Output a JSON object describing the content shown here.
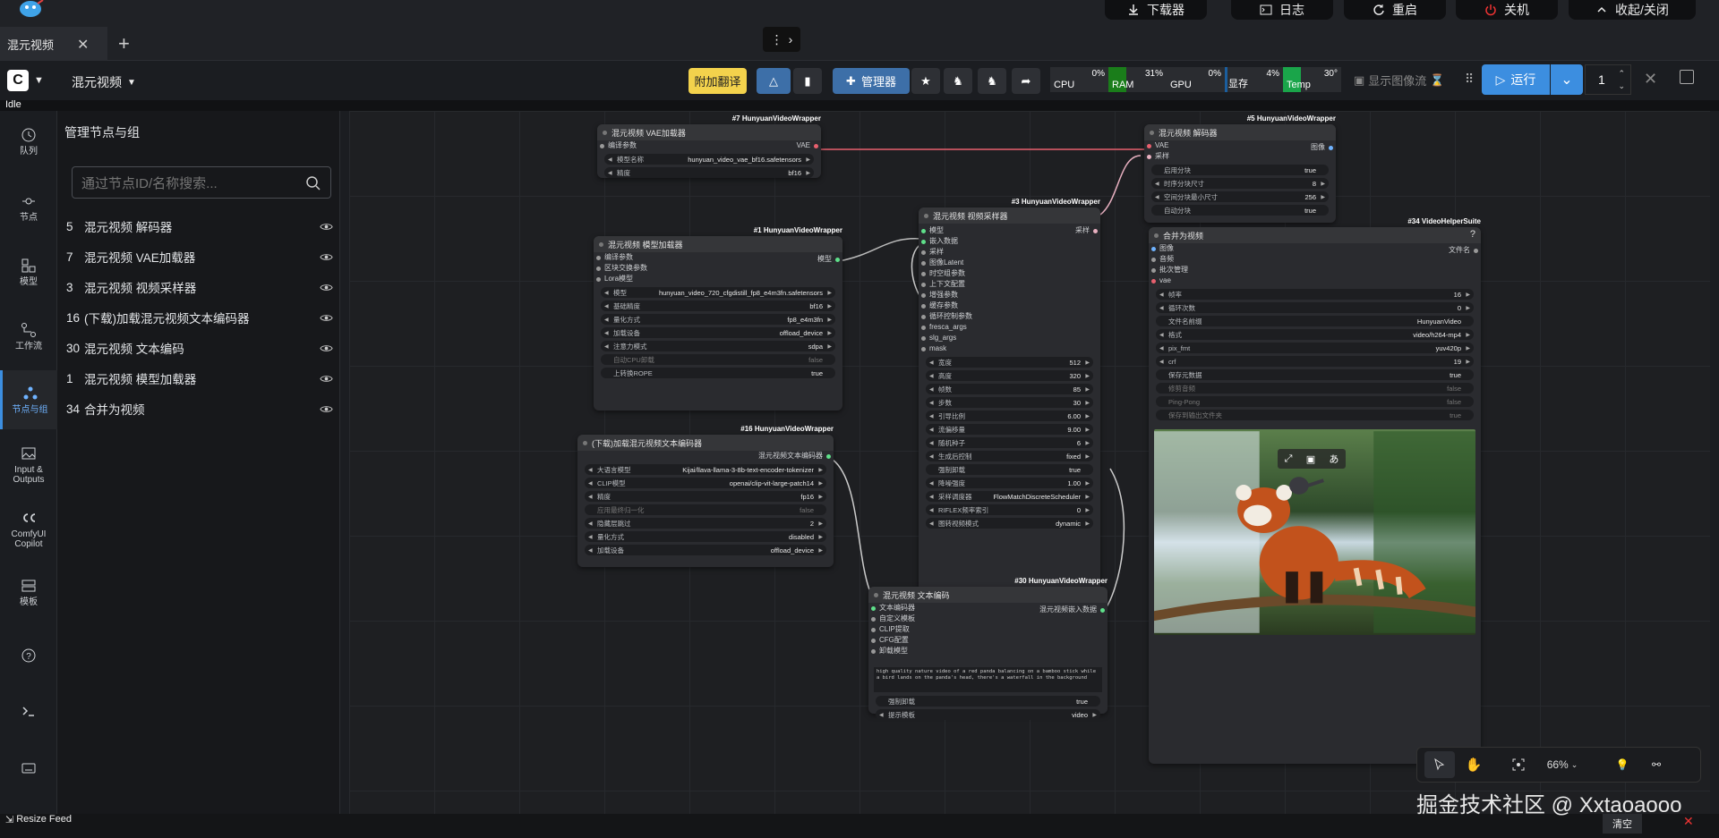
{
  "topbar": {
    "download_label": "下载器",
    "log_label": "日志",
    "restart_label": "重启",
    "shutdown_label": "关机",
    "collapse_label": "收起/关闭"
  },
  "tabs": [
    {
      "label": "混元视频"
    }
  ],
  "menubar": {
    "workflow_name": "混元视频",
    "translate_label": "附加翻译",
    "manager_label": "管理器",
    "show_image_stream_label": "显示图像流",
    "run_label": "运行",
    "queue_count": "1"
  },
  "meters": [
    {
      "label": "CPU",
      "value": "0%",
      "level": 0,
      "color": "#2a2c30"
    },
    {
      "label": "RAM",
      "value": "31%",
      "level": 31,
      "color": "#1a7d1a"
    },
    {
      "label": "GPU",
      "value": "0%",
      "level": 0,
      "color": "#2a2c30"
    },
    {
      "label": "显存",
      "value": "4%",
      "level": 4,
      "color": "#1b5e9e"
    },
    {
      "label": "Temp",
      "value": "30°",
      "level": 30,
      "color": "#1aa54a"
    }
  ],
  "status": {
    "text": "Idle"
  },
  "rail": [
    {
      "label": "队列",
      "icon": "history-icon"
    },
    {
      "label": "节点",
      "icon": "node-icon"
    },
    {
      "label": "模型",
      "icon": "model-icon"
    },
    {
      "label": "工作流",
      "icon": "workflow-icon"
    },
    {
      "label": "节点与组",
      "icon": "node-group-icon",
      "active": true
    },
    {
      "label": "Input & Outputs",
      "icon": "image-icon"
    },
    {
      "label": "ComfyUI Copilot",
      "icon": "copilot-icon"
    },
    {
      "label": "模板",
      "icon": "template-icon"
    },
    {
      "label": "",
      "icon": "help-icon"
    },
    {
      "label": "",
      "icon": "terminal-icon"
    },
    {
      "label": "",
      "icon": "keyboard-icon"
    }
  ],
  "panel": {
    "title": "管理节点与组",
    "search_placeholder": "通过节点ID/名称搜索...",
    "items": [
      {
        "id": "5",
        "name": "混元视频 解码器"
      },
      {
        "id": "7",
        "name": "混元视频 VAE加载器"
      },
      {
        "id": "3",
        "name": "混元视频 视频采样器"
      },
      {
        "id": "16",
        "name": "(下载)加载混元视频文本编码器"
      },
      {
        "id": "30",
        "name": "混元视频 文本编码"
      },
      {
        "id": "1",
        "name": "混元视频 模型加载器"
      },
      {
        "id": "34",
        "name": "合并为视频"
      }
    ]
  },
  "nodes": {
    "vae_loader": {
      "badge": "#7 HunyuanVideoWrapper",
      "title": "混元视频 VAE加载器",
      "input": "编译参数",
      "output": "VAE",
      "widgets": [
        {
          "label": "模型名称",
          "value": "hunyuan_video_vae_bf16.safetensors"
        },
        {
          "label": "精度",
          "value": "bf16"
        }
      ]
    },
    "model_loader": {
      "badge": "#1 HunyuanVideoWrapper",
      "title": "混元视频 模型加载器",
      "inputs": [
        "编译参数",
        "区块交换参数",
        "Lora模型"
      ],
      "output": "模型",
      "widgets": [
        {
          "label": "模型",
          "value": "hunyuan_video_720_cfgdistill_fp8_e4m3fn.safetensors"
        },
        {
          "label": "基础精度",
          "value": "bf16"
        },
        {
          "label": "量化方式",
          "value": "fp8_e4m3fn"
        },
        {
          "label": "加载设备",
          "value": "offload_device"
        },
        {
          "label": "注意力模式",
          "value": "sdpa"
        },
        {
          "label": "自动CPU卸载",
          "value": "false",
          "dim": true
        },
        {
          "label": "上转换ROPE",
          "value": "true",
          "toggle": true
        }
      ]
    },
    "text_encoder_loader": {
      "badge": "#16 HunyuanVideoWrapper",
      "title": "(下载)加载混元视频文本编码器",
      "output": "混元视频文本编码器",
      "widgets": [
        {
          "label": "大语言模型",
          "value": "Kijai/llava-llama-3-8b-text-encoder-tokenizer"
        },
        {
          "label": "CLIP模型",
          "value": "openai/clip-vit-large-patch14"
        },
        {
          "label": "精度",
          "value": "fp16"
        },
        {
          "label": "应用最终归一化",
          "value": "false",
          "dim": true
        },
        {
          "label": "隐藏层跳过",
          "value": "2"
        },
        {
          "label": "量化方式",
          "value": "disabled"
        },
        {
          "label": "加载设备",
          "value": "offload_device"
        }
      ]
    },
    "sampler": {
      "badge": "#3 HunyuanVideoWrapper",
      "title": "混元视频 视频采样器",
      "inputs": [
        "模型",
        "嵌入数据",
        "采样",
        "图像Latent",
        "时空组参数",
        "上下文配置",
        "增强参数",
        "缓存参数",
        "循环控制参数",
        "fresca_args",
        "slg_args",
        "mask"
      ],
      "output": "采样",
      "widgets": [
        {
          "label": "宽度",
          "value": "512"
        },
        {
          "label": "高度",
          "value": "320"
        },
        {
          "label": "帧数",
          "value": "85"
        },
        {
          "label": "步数",
          "value": "30"
        },
        {
          "label": "引导比例",
          "value": "6.00"
        },
        {
          "label": "流偏移量",
          "value": "9.00"
        },
        {
          "label": "随机种子",
          "value": "6"
        },
        {
          "label": "生成后控制",
          "value": "fixed"
        },
        {
          "label": "强制卸载",
          "value": "true",
          "toggle": true
        },
        {
          "label": "降噪强度",
          "value": "1.00"
        },
        {
          "label": "采样调度器",
          "value": "FlowMatchDiscreteScheduler"
        },
        {
          "label": "RIFLEX频率索引",
          "value": "0"
        },
        {
          "label": "图转视频模式",
          "value": "dynamic"
        }
      ]
    },
    "decoder": {
      "badge": "#5 HunyuanVideoWrapper",
      "title": "混元视频 解码器",
      "inputs": [
        "VAE",
        "采样"
      ],
      "output": "图像",
      "widgets": [
        {
          "label": "启用分块",
          "value": "true",
          "toggle": true
        },
        {
          "label": "时序分块尺寸",
          "value": "8"
        },
        {
          "label": "空间分块最小尺寸",
          "value": "256"
        },
        {
          "label": "自动分块",
          "value": "true",
          "toggle": true
        }
      ]
    },
    "combine": {
      "badge": "#34 VideoHelperSuite",
      "title": "合并为视频",
      "inputs": [
        "图像",
        "音频",
        "批次管理",
        "vae"
      ],
      "output": "文件名",
      "widgets": [
        {
          "label": "帧率",
          "value": "16"
        },
        {
          "label": "循环次数",
          "value": "0"
        },
        {
          "label": "文件名前缀",
          "value": "HunyuanVideo",
          "plain": true
        },
        {
          "label": "格式",
          "value": "video/h264-mp4"
        },
        {
          "label": "pix_fmt",
          "value": "yuv420p"
        },
        {
          "label": "crf",
          "value": "19"
        },
        {
          "label": "保存元数据",
          "value": "true",
          "toggle": true
        },
        {
          "label": "修剪音频",
          "value": "false",
          "dim": true
        },
        {
          "label": "Ping-Pong",
          "value": "false",
          "dim": true
        },
        {
          "label": "保存到输出文件夹",
          "value": "true",
          "dim": true
        }
      ]
    },
    "text_encode": {
      "badge": "#30 HunyuanVideoWrapper",
      "title": "混元视频 文本编码",
      "inputs": [
        "文本编码器",
        "自定义模板",
        "CLIP提取",
        "CFG配置",
        "卸载模型"
      ],
      "output": "混元视频嵌入数据",
      "prompt": "high quality nature video of a red panda balancing on a bamboo stick while a bird lands on the panda's head, there's a waterfall in the background",
      "widgets": [
        {
          "label": "强制卸载",
          "value": "true",
          "toggle": true
        },
        {
          "label": "提示模板",
          "value": "video"
        }
      ]
    }
  },
  "canvas_controls": {
    "zoom": "66%"
  },
  "bottom": {
    "resize_label": "Resize Feed",
    "clear_label": "清空"
  },
  "watermark": "掘金技术社区 @ Xxtaoaooo"
}
